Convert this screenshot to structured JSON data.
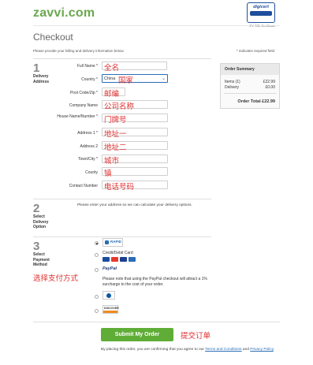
{
  "header": {
    "logo_text": "zavvi.com",
    "badge_brand": "digicert",
    "badge_caption": "EV SSL Certificate"
  },
  "page": {
    "title": "Checkout",
    "subtitle": "Please provide your billing and delivery information below.",
    "required_note": "* indicates required field"
  },
  "steps": {
    "s1": {
      "number": "1",
      "label": "Delivery Address"
    },
    "s2": {
      "number": "2",
      "label": "Select Delivery Option",
      "message": "Please enter your address so we can calculate your delivery options."
    },
    "s3": {
      "number": "3",
      "label": "Select Payment Method",
      "annotation": "选择支付方式"
    }
  },
  "form": {
    "full_name": {
      "label": "Full Name *",
      "value": "全名"
    },
    "country": {
      "label": "Country *",
      "value": "China",
      "annotation": "国家"
    },
    "postcode": {
      "label": "Post Code/Zip *",
      "value": "邮编"
    },
    "company": {
      "label": "Company Name",
      "value": "公司名称"
    },
    "house": {
      "label": "House Name/Number *",
      "value": "门牌号"
    },
    "address1": {
      "label": "Address 1 *",
      "value": "地址一"
    },
    "address2": {
      "label": "Address 2",
      "value": "地址二"
    },
    "town": {
      "label": "Town/City *",
      "value": "城市"
    },
    "county": {
      "label": "County",
      "value": "镇"
    },
    "contact": {
      "label": "Contact Number",
      "value": "电话号码"
    }
  },
  "summary": {
    "title": "Order Summary",
    "items_label": "Items (1)",
    "items_value": "£22.99",
    "delivery_label": "Delivery",
    "delivery_value": "£0.00",
    "total": "Order Total £22.99"
  },
  "payment": {
    "options": [
      {
        "name": "Rapid",
        "selected": true
      },
      {
        "name": "Credit/Debit Card",
        "selected": false
      },
      {
        "name": "PayPal",
        "selected": false
      },
      {
        "name": "Diners Club",
        "selected": false
      },
      {
        "name": "DISCOVER",
        "selected": false
      }
    ],
    "rapid_label": "RAPID",
    "card_label": "Credit/Debit Card",
    "paypal_label": "PayPal",
    "paypal_note": "Please note that using the PayPal checkout will attract a 1% surcharge to the cost of your order.",
    "discover_label": "DISCOVER"
  },
  "submit": {
    "label": "Submit My Order",
    "annotation": "提交订单"
  },
  "legal": {
    "text": "By placing this order, you are confirming that you agree to our",
    "terms_link": "Terms and Conditions",
    "and": "and",
    "privacy_link": "Privacy Policy",
    "end": "."
  },
  "colors": {
    "brand_green": "#6aa84f",
    "submit_green": "#5fad37",
    "link_blue": "#2a6db5",
    "annotation_red": "#e03030"
  }
}
